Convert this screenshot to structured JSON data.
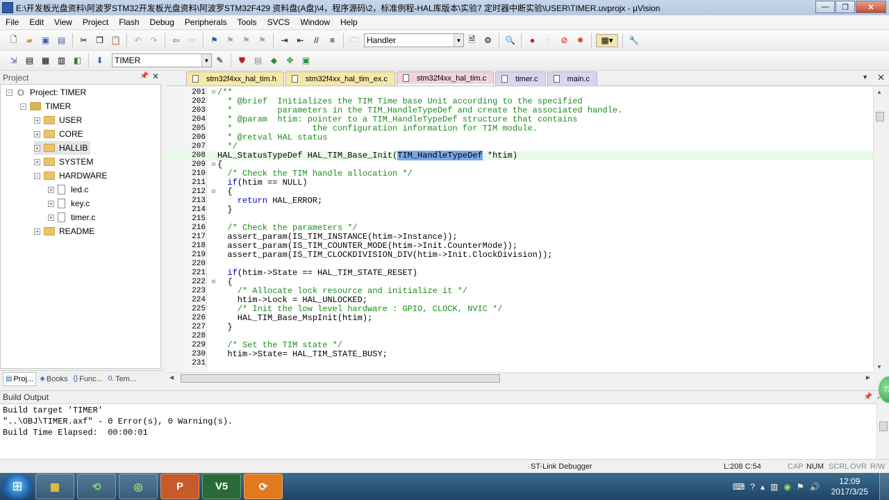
{
  "window": {
    "title": "E:\\开发板光盘资料\\阿波罗STM32开发板光盘资料\\阿波罗STM32F429 资料盘(A盘)\\4，程序源码\\2，标准例程-HAL库版本\\实验7 定时器中断实验\\USER\\TIMER.uvprojx - µVision",
    "min": "—",
    "max": "❐",
    "close": "✕"
  },
  "menu": [
    "File",
    "Edit",
    "View",
    "Project",
    "Flash",
    "Debug",
    "Peripherals",
    "Tools",
    "SVCS",
    "Window",
    "Help"
  ],
  "toolbar": {
    "find_value": "Handler",
    "target_value": "TIMER"
  },
  "project_panel": {
    "title": "Project",
    "pin": "📌",
    "close": "✕",
    "tree": {
      "root": "Project: TIMER",
      "target": "TIMER",
      "groups": [
        "USER",
        "CORE",
        "HALLIB",
        "SYSTEM",
        "HARDWARE"
      ],
      "hardware_files": [
        "led.c",
        "key.c",
        "timer.c"
      ],
      "last_group": "README"
    },
    "tabs": [
      {
        "icon": "▤",
        "label": "Proj..."
      },
      {
        "icon": "◈",
        "label": "Books"
      },
      {
        "icon": "{}",
        "label": "Func..."
      },
      {
        "icon": "0.",
        "label": "Tem..."
      }
    ]
  },
  "editor": {
    "tabs": [
      {
        "label": "stm32f4xx_hal_tim.h",
        "color": "y"
      },
      {
        "label": "stm32f4xx_hal_tim_ex.c",
        "color": "y"
      },
      {
        "label": "stm32f4xx_hal_tim.c",
        "color": "active"
      },
      {
        "label": "timer.c",
        "color": "p"
      },
      {
        "label": "main.c",
        "color": "p"
      }
    ],
    "lines": [
      {
        "n": "201",
        "fold": "⊟",
        "parts": [
          [
            "cm",
            "/**"
          ]
        ]
      },
      {
        "n": "202",
        "fold": "",
        "parts": [
          [
            "cm",
            "  * @brief  Initializes the TIM Time base Unit according to the specified"
          ]
        ]
      },
      {
        "n": "203",
        "fold": "",
        "parts": [
          [
            "cm",
            "  *         parameters in the TIM_HandleTypeDef and create the associated handle."
          ]
        ]
      },
      {
        "n": "204",
        "fold": "",
        "parts": [
          [
            "cm",
            "  * @param  htim: pointer to a TIM_HandleTypeDef structure that contains"
          ]
        ]
      },
      {
        "n": "205",
        "fold": "",
        "parts": [
          [
            "cm",
            "  *                the configuration information for TIM module."
          ]
        ]
      },
      {
        "n": "206",
        "fold": "",
        "parts": [
          [
            "cm",
            "  * @retval HAL status"
          ]
        ]
      },
      {
        "n": "207",
        "fold": "",
        "parts": [
          [
            "cm",
            "  */"
          ]
        ]
      },
      {
        "n": "208",
        "fold": "",
        "cur": true,
        "parts": [
          [
            "",
            "HAL_StatusTypeDef HAL_TIM_Base_Init("
          ],
          [
            "sel",
            "TIM_HandleTypeDef"
          ],
          [
            "",
            " *htim)"
          ]
        ]
      },
      {
        "n": "209",
        "fold": "⊟",
        "parts": [
          [
            "",
            "{"
          ]
        ]
      },
      {
        "n": "210",
        "fold": "",
        "parts": [
          [
            "cm",
            "  /* Check the TIM handle allocation */"
          ]
        ]
      },
      {
        "n": "211",
        "fold": "",
        "parts": [
          [
            "kw",
            "  if"
          ],
          [
            "",
            "(htim == NULL)"
          ]
        ]
      },
      {
        "n": "212",
        "fold": "⊟",
        "parts": [
          [
            "",
            "  {"
          ]
        ]
      },
      {
        "n": "213",
        "fold": "",
        "parts": [
          [
            "kw",
            "    return"
          ],
          [
            "",
            " HAL_ERROR;"
          ]
        ]
      },
      {
        "n": "214",
        "fold": "",
        "parts": [
          [
            "",
            "  }"
          ]
        ]
      },
      {
        "n": "215",
        "fold": "",
        "parts": [
          [
            "",
            ""
          ]
        ]
      },
      {
        "n": "216",
        "fold": "",
        "parts": [
          [
            "cm",
            "  /* Check the parameters */"
          ]
        ]
      },
      {
        "n": "217",
        "fold": "",
        "parts": [
          [
            "",
            "  assert_param(IS_TIM_INSTANCE(htim->Instance));"
          ]
        ]
      },
      {
        "n": "218",
        "fold": "",
        "parts": [
          [
            "",
            "  assert_param(IS_TIM_COUNTER_MODE(htim->Init.CounterMode));"
          ]
        ]
      },
      {
        "n": "219",
        "fold": "",
        "parts": [
          [
            "",
            "  assert_param(IS_TIM_CLOCKDIVISION_DIV(htim->Init.ClockDivision));"
          ]
        ]
      },
      {
        "n": "220",
        "fold": "",
        "parts": [
          [
            "",
            ""
          ]
        ]
      },
      {
        "n": "221",
        "fold": "",
        "parts": [
          [
            "kw",
            "  if"
          ],
          [
            "",
            "(htim->State == HAL_TIM_STATE_RESET)"
          ]
        ]
      },
      {
        "n": "222",
        "fold": "⊟",
        "parts": [
          [
            "",
            "  {"
          ]
        ]
      },
      {
        "n": "223",
        "fold": "",
        "parts": [
          [
            "cm",
            "    /* Allocate lock resource and initialize it */"
          ]
        ]
      },
      {
        "n": "224",
        "fold": "",
        "parts": [
          [
            "",
            "    htim->Lock = HAL_UNLOCKED;"
          ]
        ]
      },
      {
        "n": "225",
        "fold": "",
        "parts": [
          [
            "cm",
            "    /* Init the low level hardware : GPIO, CLOCK, NVIC */"
          ]
        ]
      },
      {
        "n": "226",
        "fold": "",
        "parts": [
          [
            "",
            "    HAL_TIM_Base_MspInit(htim);"
          ]
        ]
      },
      {
        "n": "227",
        "fold": "",
        "parts": [
          [
            "",
            "  }"
          ]
        ]
      },
      {
        "n": "228",
        "fold": "",
        "parts": [
          [
            "",
            ""
          ]
        ]
      },
      {
        "n": "229",
        "fold": "",
        "parts": [
          [
            "cm",
            "  /* Set the TIM state */"
          ]
        ]
      },
      {
        "n": "230",
        "fold": "",
        "parts": [
          [
            "",
            "  htim->State= HAL_TIM_STATE_BUSY;"
          ]
        ]
      },
      {
        "n": "231",
        "fold": "",
        "parts": [
          [
            "",
            ""
          ]
        ]
      }
    ]
  },
  "build_output": {
    "title": "Build Output",
    "lines": [
      "Build target 'TIMER'",
      "\"..\\OBJ\\TIMER.axf\" - 0 Error(s), 0 Warning(s).",
      "Build Time Elapsed:  00:00:01"
    ]
  },
  "status": {
    "debugger": "ST-Link Debugger",
    "position": "L:208 C:54",
    "caps": "CAP",
    "num": "NUM",
    "scrl": "SCRL",
    "ovr": "OVR",
    "rw": "R/W"
  },
  "taskbar": {
    "apps": [
      "▦",
      "⟲",
      "◎",
      "P",
      "V5",
      "⟳"
    ],
    "time": "12:09",
    "date": "2017/3/25"
  },
  "overlay": {
    "badge": "73"
  }
}
